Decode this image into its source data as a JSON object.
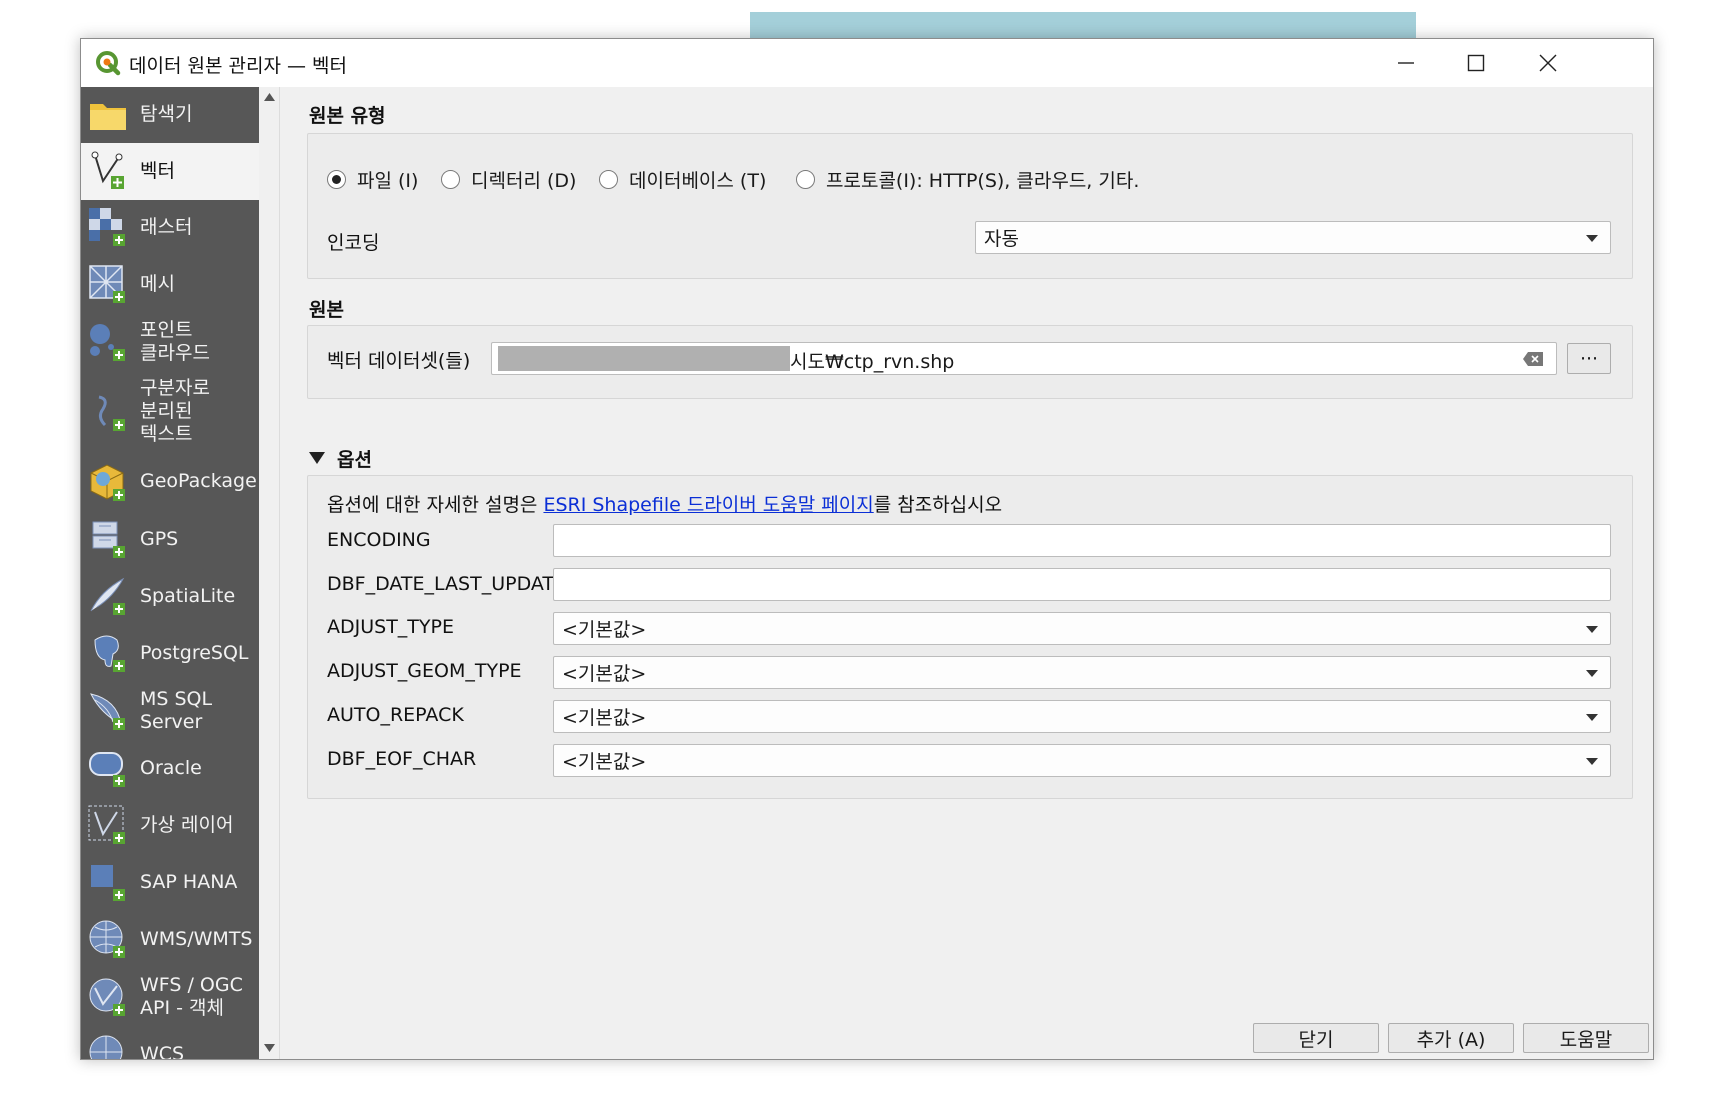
{
  "window": {
    "title": "데이터 원본 관리자 — 벡터"
  },
  "sidebar": {
    "items": [
      {
        "label": "탐색기",
        "icon": "folder-icon"
      },
      {
        "label": "벡터",
        "icon": "vector-icon",
        "selected": true
      },
      {
        "label": "래스터",
        "icon": "raster-icon"
      },
      {
        "label": "메시",
        "icon": "mesh-icon"
      },
      {
        "label": "포인트\n클라우드",
        "icon": "point-cloud-icon"
      },
      {
        "label": "구분자로\n분리된\n텍스트",
        "icon": "delimited-text-icon"
      },
      {
        "label": "GeoPackage",
        "icon": "geopackage-icon"
      },
      {
        "label": "GPS",
        "icon": "gps-icon"
      },
      {
        "label": "SpatiaLite",
        "icon": "spatialite-icon"
      },
      {
        "label": "PostgreSQL",
        "icon": "postgresql-icon"
      },
      {
        "label": "MS SQL\nServer",
        "icon": "mssql-icon"
      },
      {
        "label": "Oracle",
        "icon": "oracle-icon"
      },
      {
        "label": "가상 레이어",
        "icon": "virtual-layer-icon"
      },
      {
        "label": "SAP HANA",
        "icon": "sap-hana-icon"
      },
      {
        "label": "WMS/WMTS",
        "icon": "wms-icon"
      },
      {
        "label": "WFS / OGC\nAPI - 객체",
        "icon": "wfs-icon"
      },
      {
        "label": "WCS",
        "icon": "wcs-icon"
      }
    ]
  },
  "source_type": {
    "title": "원본 유형",
    "options": [
      "파일 (I)",
      "디렉터리 (D)",
      "데이터베이스 (T)",
      "프로토콜(I): HTTP(S), 클라우드, 기타."
    ],
    "selected_index": 0,
    "encoding_label": "인코딩",
    "encoding_value": "자동"
  },
  "source": {
    "title": "원본",
    "dataset_label": "벡터 데이터셋(들)",
    "dataset_value": "시도₩ctp_rvn.shp",
    "browse_label": "···"
  },
  "options": {
    "title": "옵션",
    "description_prefix": "옵션에 대한 자세한 설명은 ",
    "description_link": "ESRI Shapefile 드라이버 도움말 페이지",
    "description_suffix": "를 참조하십시오",
    "fields": [
      {
        "label": "ENCODING",
        "kind": "text",
        "value": ""
      },
      {
        "label": "DBF_DATE_LAST_UPDATE",
        "kind": "text",
        "value": ""
      },
      {
        "label": "ADJUST_TYPE",
        "kind": "combo",
        "value": "<기본값>"
      },
      {
        "label": "ADJUST_GEOM_TYPE",
        "kind": "combo",
        "value": "<기본값>"
      },
      {
        "label": "AUTO_REPACK",
        "kind": "combo",
        "value": "<기본값>"
      },
      {
        "label": "DBF_EOF_CHAR",
        "kind": "combo",
        "value": "<기본값>"
      }
    ]
  },
  "footer": {
    "close_label": "닫기",
    "add_label": "추가 (A)",
    "help_label": "도움말"
  }
}
